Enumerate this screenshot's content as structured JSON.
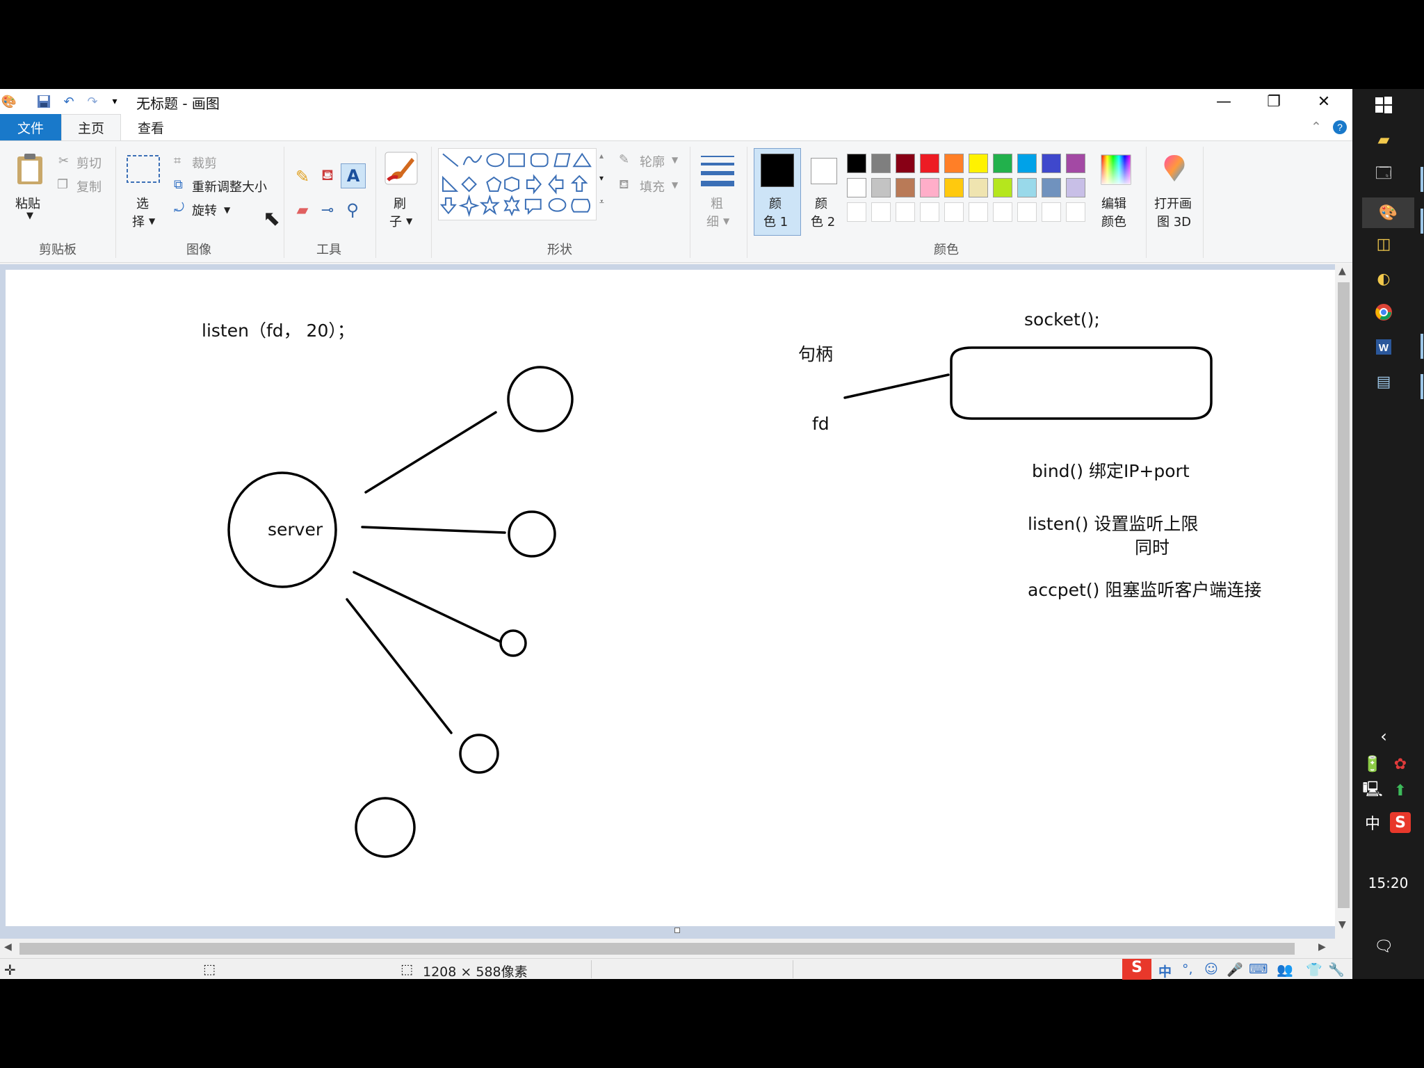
{
  "window": {
    "title": "无标题 - 画图",
    "minimize": "—",
    "restore": "❐",
    "close": "✕"
  },
  "tabs": [
    {
      "label": "文件"
    },
    {
      "label": "主页"
    },
    {
      "label": "查看"
    }
  ],
  "ribbon": {
    "clipboard": {
      "label": "剪贴板",
      "paste": "粘贴",
      "cut": "剪切",
      "copy": "复制"
    },
    "image": {
      "label": "图像",
      "select_1": "选",
      "select_2": "择",
      "crop": "裁剪",
      "resize": "重新调整大小",
      "rotate": "旋转"
    },
    "tools": {
      "label": "工具"
    },
    "brush": {
      "label_1": "刷",
      "label_2": "子"
    },
    "shapes": {
      "label": "形状",
      "outline": "轮廓",
      "fill": "填充"
    },
    "size": {
      "label_1": "粗",
      "label_2": "细"
    },
    "color1": {
      "label_1": "颜",
      "label_2": "色 1",
      "color": "#000000"
    },
    "color2": {
      "label_1": "颜",
      "label_2": "色 2",
      "color": "#ffffff"
    },
    "colors": {
      "label": "颜色",
      "row1": [
        "#000000",
        "#7f7f7f",
        "#880015",
        "#ed1c24",
        "#ff7f27",
        "#fff200",
        "#22b14c",
        "#00a2e8",
        "#3f48cc",
        "#a349a4"
      ],
      "row2": [
        "#ffffff",
        "#c3c3c3",
        "#b97a57",
        "#ffaec9",
        "#ffc90e",
        "#efe4b0",
        "#b5e61d",
        "#99d9ea",
        "#7092be",
        "#c8bfe7"
      ],
      "edit_1": "编辑",
      "edit_2": "颜色"
    },
    "paint3d": {
      "label_1": "打开画",
      "label_2": "图 3D"
    }
  },
  "canvas": {
    "listen_call": "listen（fd， 20）；",
    "server": "server",
    "handle": "句柄",
    "fd": "fd",
    "socket": "socket();",
    "bind": "bind() 绑定IP+port",
    "listen": "listen() 设置监听上限",
    "simultaneous": "同时",
    "accept": "accpet() 阻塞监听客户端连接"
  },
  "status": {
    "size": "1208 × 588像素"
  },
  "taskbar": {
    "time": "15:20",
    "ime": "中"
  }
}
